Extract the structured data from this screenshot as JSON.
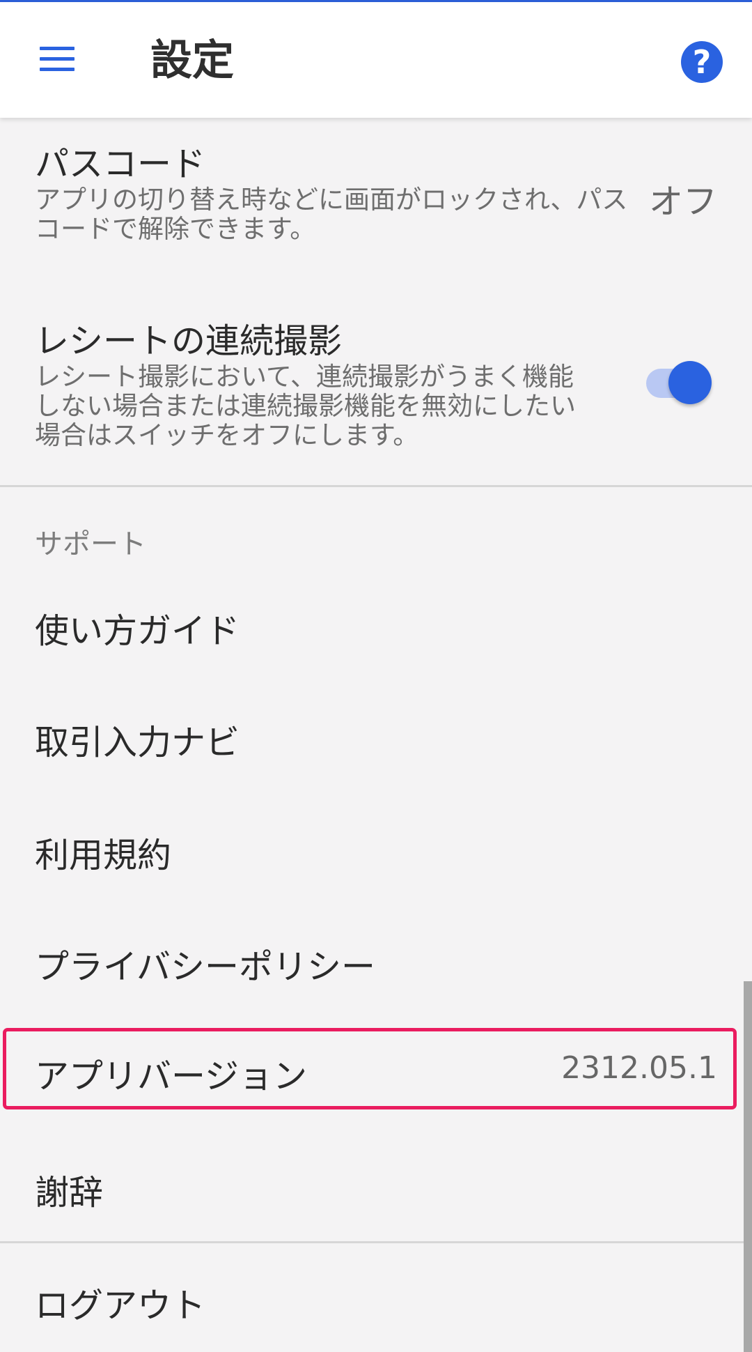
{
  "header": {
    "title": "設定",
    "menu_icon": "hamburger-menu-icon",
    "help_icon": "help-icon",
    "help_glyph": "?"
  },
  "passcode": {
    "title": "パスコード",
    "description": "アプリの切り替え時などに画面がロックされ、パスコードで解除できます。",
    "value": "オフ"
  },
  "receipt_burst": {
    "title": "レシートの連続撮影",
    "description": "レシート撮影において、連続撮影がうまく機能しない場合または連続撮影機能を無効にしたい場合はスイッチをオフにします。",
    "enabled": true
  },
  "support": {
    "header": "サポート",
    "items": [
      {
        "label": "使い方ガイド"
      },
      {
        "label": "取引入力ナビ"
      },
      {
        "label": "利用規約"
      },
      {
        "label": "プライバシーポリシー"
      }
    ],
    "app_version": {
      "label": "アプリバージョン",
      "value": "2312.05.1"
    },
    "acknowledgements": {
      "label": "謝辞"
    }
  },
  "logout": {
    "label": "ログアウト"
  },
  "colors": {
    "accent": "#2a62e0",
    "highlight": "#ea1c5f",
    "background": "#f4f3f4"
  }
}
